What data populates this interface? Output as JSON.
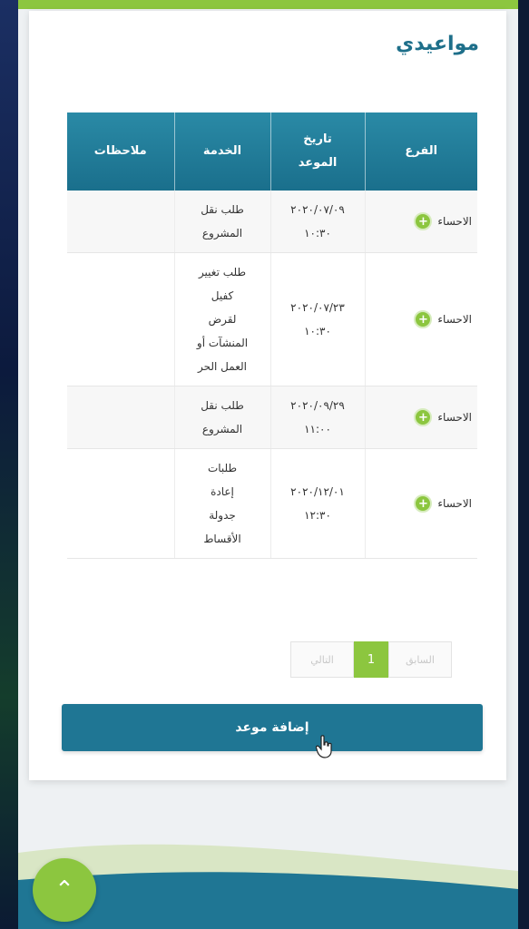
{
  "page": {
    "title": "مواعيدي"
  },
  "table": {
    "headers": {
      "branch": "الفرع",
      "date_line1": "تاريخ",
      "date_line2": "الموعد",
      "service": "الخدمة",
      "notes": "ملاحظات"
    },
    "rows": [
      {
        "branch": "الاحساء",
        "date": "٢٠٢٠/٠٧/٠٩",
        "time": "١٠:٣٠",
        "service": [
          "طلب نقل",
          "المشروع"
        ],
        "notes": ""
      },
      {
        "branch": "الاحساء",
        "date": "٢٠٢٠/٠٧/٢٣",
        "time": "١٠:٣٠",
        "service": [
          "طلب تغيير",
          "كفيل",
          "لقرض",
          "المنشآت أو",
          "العمل الحر"
        ],
        "notes": ""
      },
      {
        "branch": "الاحساء",
        "date": "٢٠٢٠/٠٩/٢٩",
        "time": "١١:٠٠",
        "service": [
          "طلب نقل",
          "المشروع"
        ],
        "notes": ""
      },
      {
        "branch": "الاحساء",
        "date": "٢٠٢٠/١٢/٠١",
        "time": "١٢:٣٠",
        "service": [
          "طلبات",
          "إعادة",
          "جدولة",
          "الأقساط"
        ],
        "notes": ""
      }
    ]
  },
  "pagination": {
    "previous_label": "السابق",
    "current_page": "1",
    "next_label": "التالي"
  },
  "actions": {
    "add_appointment_label": "إضافة موعد"
  },
  "colors": {
    "accent_green": "#8cc63f",
    "header_blue": "#1f7694",
    "title_blue": "#1e6f8a"
  },
  "icons": {
    "row_expand": "plus-circle-icon",
    "scroll_top": "chevron-up-icon"
  }
}
